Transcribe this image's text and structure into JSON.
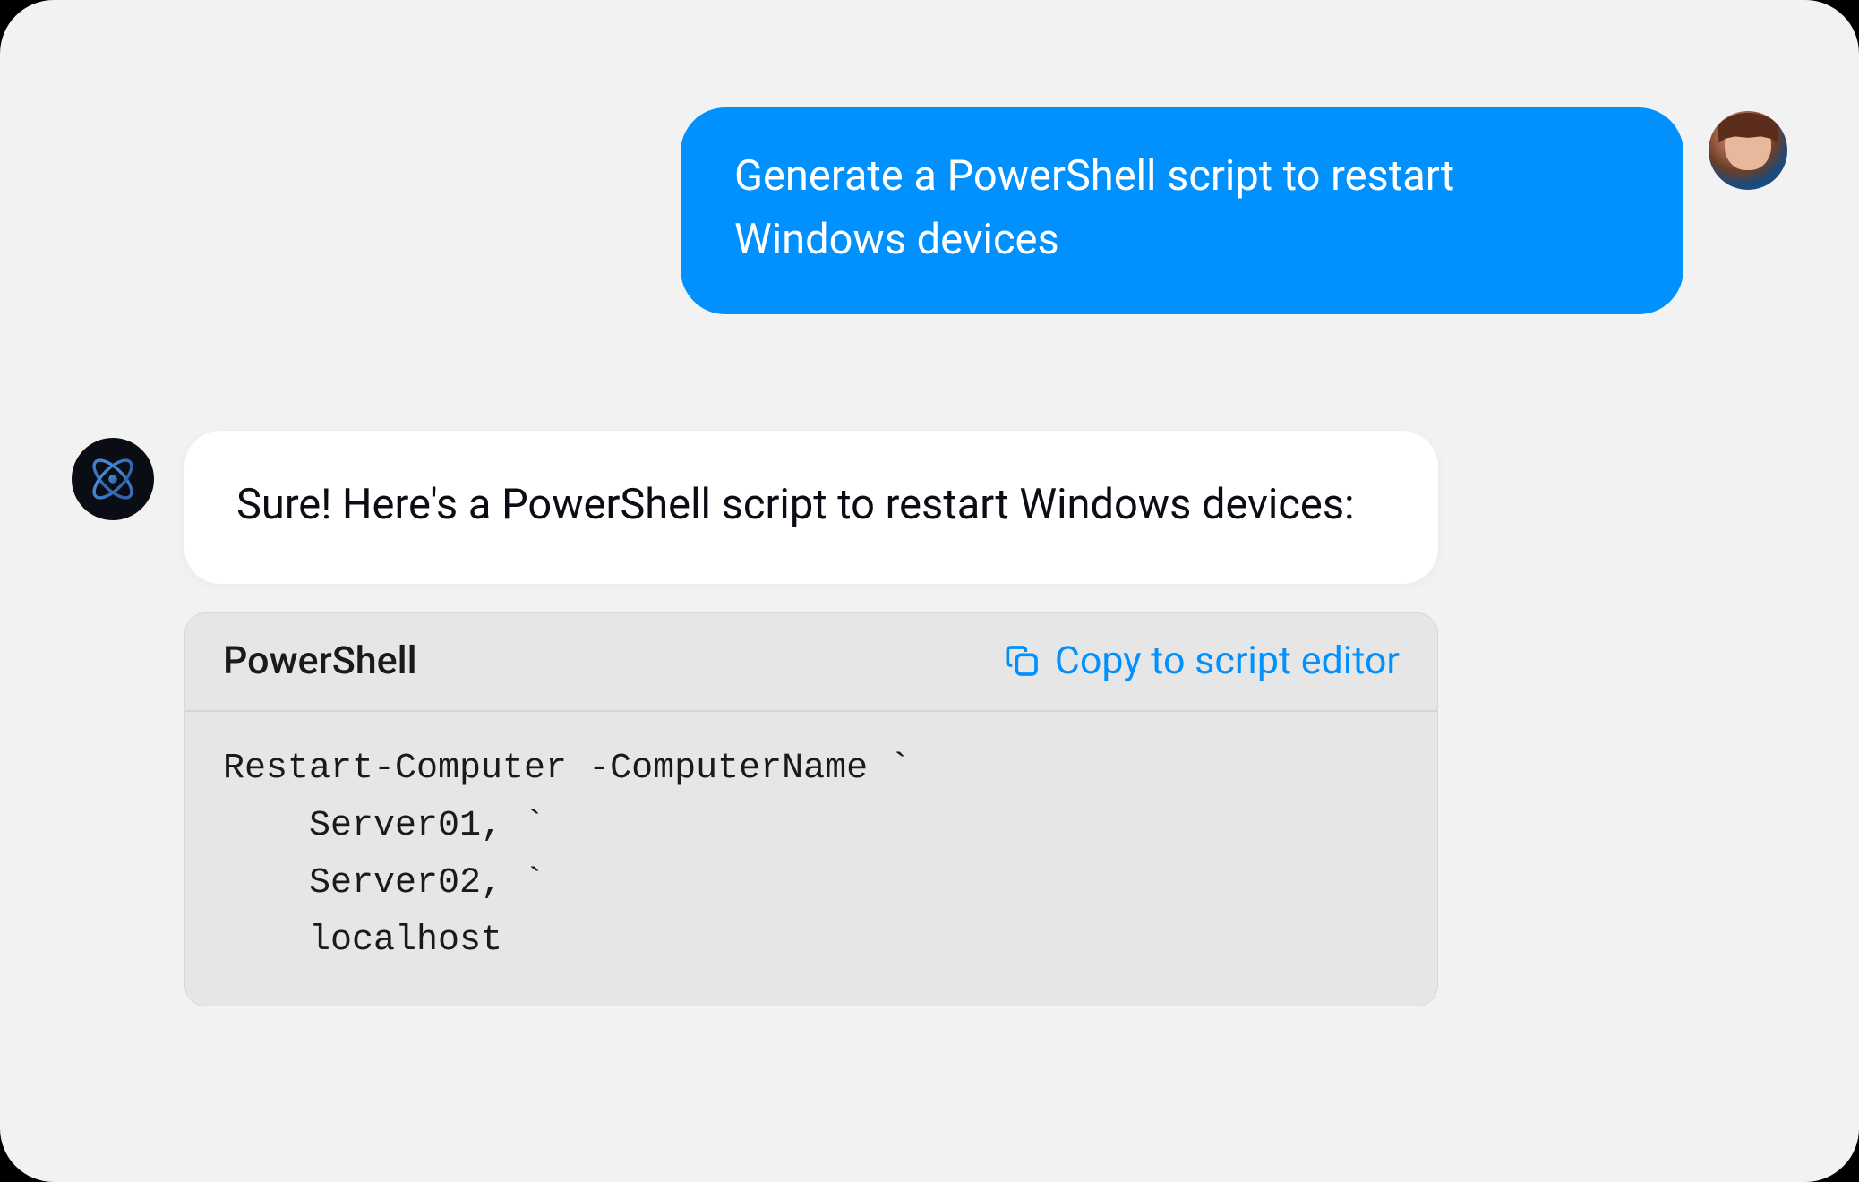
{
  "user_message": {
    "text": "Generate a PowerShell script to restart Windows devices"
  },
  "bot_message": {
    "text": "Sure! Here's a PowerShell script to restart Windows devices:"
  },
  "code_block": {
    "language": "PowerShell",
    "copy_label": "Copy to script editor",
    "code": "Restart-Computer -ComputerName `\n    Server01, `\n    Server02, `\n    localhost"
  },
  "icons": {
    "bot_avatar": "atom-icon",
    "copy": "copy-icon"
  },
  "colors": {
    "user_bubble": "#0091ff",
    "bot_bubble": "#ffffff",
    "code_bg": "#e6e6e6",
    "accent": "#0091ff"
  }
}
